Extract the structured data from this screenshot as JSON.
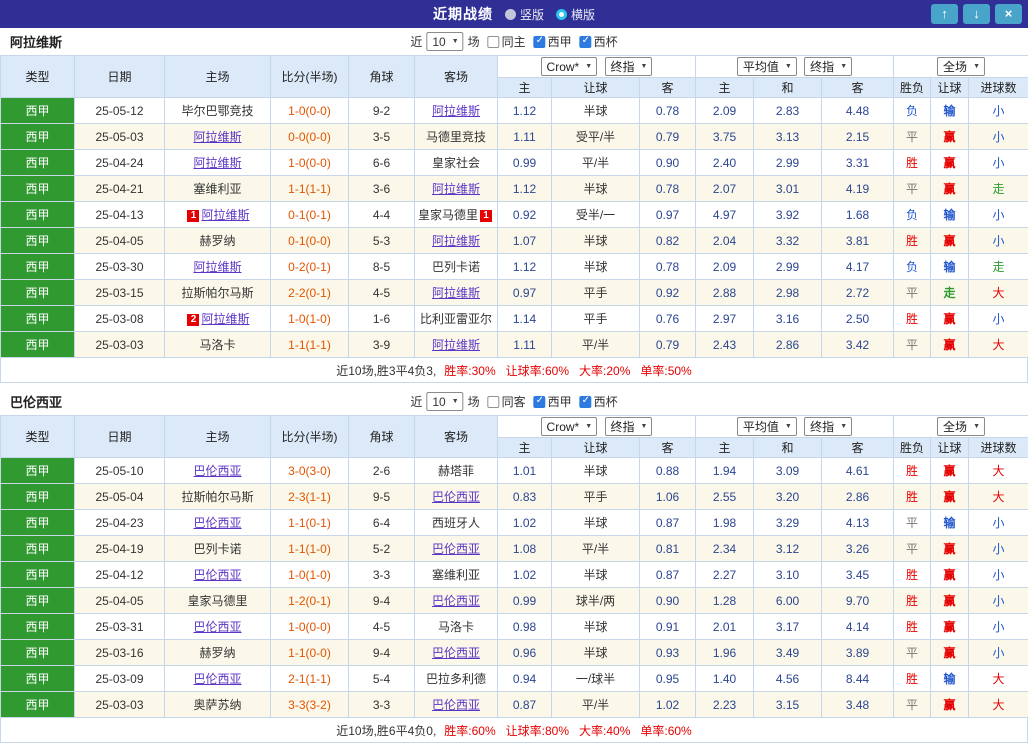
{
  "topbar": {
    "title": "近期战绩",
    "layout_options": [
      {
        "label": "竖版",
        "selected": false
      },
      {
        "label": "横版",
        "selected": true
      }
    ],
    "up_icon": "↑",
    "down_icon": "↓",
    "close_icon": "×"
  },
  "columns": {
    "type": "类型",
    "date": "日期",
    "home": "主场",
    "score": "比分(半场)",
    "corners": "角球",
    "away": "客场",
    "asian_home": "主",
    "asian_line": "让球",
    "asian_away": "客",
    "euro_home": "主",
    "euro_draw": "和",
    "euro_away": "客",
    "outcome": "胜负",
    "handicap": "让球",
    "goals": "进球数"
  },
  "sections": [
    {
      "team": "阿拉维斯",
      "filter": {
        "near_label": "近",
        "count": "10",
        "games_label": "场",
        "checkboxes": [
          {
            "label": "同主",
            "checked": false
          },
          {
            "label": "西甲",
            "checked": true
          },
          {
            "label": "西杯",
            "checked": true
          }
        ]
      },
      "selects": {
        "bookmaker": "Crow*",
        "bookmaker_mode": "终指",
        "euro": "平均值",
        "euro_mode": "终指",
        "scope": "全场"
      },
      "rows": [
        {
          "league": "西甲",
          "date": "25-05-12",
          "home": {
            "name": "毕尔巴鄂竞技"
          },
          "score": "1-0(0-0)",
          "corners": "9-2",
          "away": {
            "name": "阿拉维斯",
            "focal": true
          },
          "asian_home": "1.12",
          "asian_line": "半球",
          "asian_away": "0.78",
          "euro_home": "2.09",
          "euro_draw": "2.83",
          "euro_away": "4.48",
          "outcome": "负",
          "handicap_result": "输",
          "goal_result": "小"
        },
        {
          "league": "西甲",
          "date": "25-05-03",
          "home": {
            "name": "阿拉维斯",
            "focal": true
          },
          "score": "0-0(0-0)",
          "corners": "3-5",
          "away": {
            "name": "马德里竞技"
          },
          "asian_home": "1.11",
          "asian_line": "受平/半",
          "asian_away": "0.79",
          "euro_home": "3.75",
          "euro_draw": "3.13",
          "euro_away": "2.15",
          "outcome": "平",
          "handicap_result": "赢",
          "goal_result": "小"
        },
        {
          "league": "西甲",
          "date": "25-04-24",
          "home": {
            "name": "阿拉维斯",
            "focal": true
          },
          "score": "1-0(0-0)",
          "corners": "6-6",
          "away": {
            "name": "皇家社会"
          },
          "asian_home": "0.99",
          "asian_line": "平/半",
          "asian_away": "0.90",
          "euro_home": "2.40",
          "euro_draw": "2.99",
          "euro_away": "3.31",
          "outcome": "胜",
          "handicap_result": "赢",
          "goal_result": "小"
        },
        {
          "league": "西甲",
          "date": "25-04-21",
          "home": {
            "name": "塞维利亚"
          },
          "score": "1-1(1-1)",
          "corners": "3-6",
          "away": {
            "name": "阿拉维斯",
            "focal": true
          },
          "asian_home": "1.12",
          "asian_line": "半球",
          "asian_away": "0.78",
          "euro_home": "2.07",
          "euro_draw": "3.01",
          "euro_away": "4.19",
          "outcome": "平",
          "handicap_result": "赢",
          "goal_result": "走"
        },
        {
          "league": "西甲",
          "date": "25-04-13",
          "home": {
            "name": "阿拉维斯",
            "focal": true,
            "badge": "1",
            "badge_pos": "before"
          },
          "score": "0-1(0-1)",
          "corners": "4-4",
          "away": {
            "name": "皇家马德里",
            "badge": "1",
            "badge_pos": "after"
          },
          "asian_home": "0.92",
          "asian_line": "受半/一",
          "asian_away": "0.97",
          "euro_home": "4.97",
          "euro_draw": "3.92",
          "euro_away": "1.68",
          "outcome": "负",
          "handicap_result": "输",
          "goal_result": "小"
        },
        {
          "league": "西甲",
          "date": "25-04-05",
          "home": {
            "name": "赫罗纳"
          },
          "score": "0-1(0-0)",
          "corners": "5-3",
          "away": {
            "name": "阿拉维斯",
            "focal": true
          },
          "asian_home": "1.07",
          "asian_line": "半球",
          "asian_away": "0.82",
          "euro_home": "2.04",
          "euro_draw": "3.32",
          "euro_away": "3.81",
          "outcome": "胜",
          "handicap_result": "赢",
          "goal_result": "小"
        },
        {
          "league": "西甲",
          "date": "25-03-30",
          "home": {
            "name": "阿拉维斯",
            "focal": true
          },
          "score": "0-2(0-1)",
          "corners": "8-5",
          "away": {
            "name": "巴列卡诺"
          },
          "asian_home": "1.12",
          "asian_line": "半球",
          "asian_away": "0.78",
          "euro_home": "2.09",
          "euro_draw": "2.99",
          "euro_away": "4.17",
          "outcome": "负",
          "handicap_result": "输",
          "goal_result": "走"
        },
        {
          "league": "西甲",
          "date": "25-03-15",
          "home": {
            "name": "拉斯帕尔马斯"
          },
          "score": "2-2(0-1)",
          "corners": "4-5",
          "away": {
            "name": "阿拉维斯",
            "focal": true
          },
          "asian_home": "0.97",
          "asian_line": "平手",
          "asian_away": "0.92",
          "euro_home": "2.88",
          "euro_draw": "2.98",
          "euro_away": "2.72",
          "outcome": "平",
          "handicap_result": "走",
          "goal_result": "大"
        },
        {
          "league": "西甲",
          "date": "25-03-08",
          "home": {
            "name": "阿拉维斯",
            "focal": true,
            "badge": "2",
            "badge_pos": "before"
          },
          "score": "1-0(1-0)",
          "corners": "1-6",
          "away": {
            "name": "比利亚雷亚尔"
          },
          "asian_home": "1.14",
          "asian_line": "平手",
          "asian_away": "0.76",
          "euro_home": "2.97",
          "euro_draw": "3.16",
          "euro_away": "2.50",
          "outcome": "胜",
          "handicap_result": "赢",
          "goal_result": "小"
        },
        {
          "league": "西甲",
          "date": "25-03-03",
          "home": {
            "name": "马洛卡"
          },
          "score": "1-1(1-1)",
          "corners": "3-9",
          "away": {
            "name": "阿拉维斯",
            "focal": true
          },
          "asian_home": "1.11",
          "asian_line": "平/半",
          "asian_away": "0.79",
          "euro_home": "2.43",
          "euro_draw": "2.86",
          "euro_away": "3.42",
          "outcome": "平",
          "handicap_result": "赢",
          "goal_result": "大"
        }
      ],
      "summary": {
        "prefix": "近10场,胜3平4负3,",
        "stats": [
          "胜率:30%",
          "让球率:60%",
          "大率:20%",
          "单率:50%"
        ]
      }
    },
    {
      "team": "巴伦西亚",
      "filter": {
        "near_label": "近",
        "count": "10",
        "games_label": "场",
        "checkboxes": [
          {
            "label": "同客",
            "checked": false
          },
          {
            "label": "西甲",
            "checked": true
          },
          {
            "label": "西杯",
            "checked": true
          }
        ]
      },
      "selects": {
        "bookmaker": "Crow*",
        "bookmaker_mode": "终指",
        "euro": "平均值",
        "euro_mode": "终指",
        "scope": "全场"
      },
      "rows": [
        {
          "league": "西甲",
          "date": "25-05-10",
          "home": {
            "name": "巴伦西亚",
            "focal": true
          },
          "score": "3-0(3-0)",
          "corners": "2-6",
          "away": {
            "name": "赫塔菲"
          },
          "asian_home": "1.01",
          "asian_line": "半球",
          "asian_away": "0.88",
          "euro_home": "1.94",
          "euro_draw": "3.09",
          "euro_away": "4.61",
          "outcome": "胜",
          "handicap_result": "赢",
          "goal_result": "大"
        },
        {
          "league": "西甲",
          "date": "25-05-04",
          "home": {
            "name": "拉斯帕尔马斯"
          },
          "score": "2-3(1-1)",
          "corners": "9-5",
          "away": {
            "name": "巴伦西亚",
            "focal": true
          },
          "asian_home": "0.83",
          "asian_line": "平手",
          "asian_away": "1.06",
          "euro_home": "2.55",
          "euro_draw": "3.20",
          "euro_away": "2.86",
          "outcome": "胜",
          "handicap_result": "赢",
          "goal_result": "大"
        },
        {
          "league": "西甲",
          "date": "25-04-23",
          "home": {
            "name": "巴伦西亚",
            "focal": true
          },
          "score": "1-1(0-1)",
          "corners": "6-4",
          "away": {
            "name": "西班牙人"
          },
          "asian_home": "1.02",
          "asian_line": "半球",
          "asian_away": "0.87",
          "euro_home": "1.98",
          "euro_draw": "3.29",
          "euro_away": "4.13",
          "outcome": "平",
          "handicap_result": "输",
          "goal_result": "小"
        },
        {
          "league": "西甲",
          "date": "25-04-19",
          "home": {
            "name": "巴列卡诺"
          },
          "score": "1-1(1-0)",
          "corners": "5-2",
          "away": {
            "name": "巴伦西亚",
            "focal": true
          },
          "asian_home": "1.08",
          "asian_line": "平/半",
          "asian_away": "0.81",
          "euro_home": "2.34",
          "euro_draw": "3.12",
          "euro_away": "3.26",
          "outcome": "平",
          "handicap_result": "赢",
          "goal_result": "小"
        },
        {
          "league": "西甲",
          "date": "25-04-12",
          "home": {
            "name": "巴伦西亚",
            "focal": true
          },
          "score": "1-0(1-0)",
          "corners": "3-3",
          "away": {
            "name": "塞维利亚"
          },
          "asian_home": "1.02",
          "asian_line": "半球",
          "asian_away": "0.87",
          "euro_home": "2.27",
          "euro_draw": "3.10",
          "euro_away": "3.45",
          "outcome": "胜",
          "handicap_result": "赢",
          "goal_result": "小"
        },
        {
          "league": "西甲",
          "date": "25-04-05",
          "home": {
            "name": "皇家马德里"
          },
          "score": "1-2(0-1)",
          "corners": "9-4",
          "away": {
            "name": "巴伦西亚",
            "focal": true
          },
          "asian_home": "0.99",
          "asian_line": "球半/两",
          "asian_away": "0.90",
          "euro_home": "1.28",
          "euro_draw": "6.00",
          "euro_away": "9.70",
          "outcome": "胜",
          "handicap_result": "赢",
          "goal_result": "小"
        },
        {
          "league": "西甲",
          "date": "25-03-31",
          "home": {
            "name": "巴伦西亚",
            "focal": true
          },
          "score": "1-0(0-0)",
          "corners": "4-5",
          "away": {
            "name": "马洛卡"
          },
          "asian_home": "0.98",
          "asian_line": "半球",
          "asian_away": "0.91",
          "euro_home": "2.01",
          "euro_draw": "3.17",
          "euro_away": "4.14",
          "outcome": "胜",
          "handicap_result": "赢",
          "goal_result": "小"
        },
        {
          "league": "西甲",
          "date": "25-03-16",
          "home": {
            "name": "赫罗纳"
          },
          "score": "1-1(0-0)",
          "corners": "9-4",
          "away": {
            "name": "巴伦西亚",
            "focal": true
          },
          "asian_home": "0.96",
          "asian_line": "半球",
          "asian_away": "0.93",
          "euro_home": "1.96",
          "euro_draw": "3.49",
          "euro_away": "3.89",
          "outcome": "平",
          "handicap_result": "赢",
          "goal_result": "小"
        },
        {
          "league": "西甲",
          "date": "25-03-09",
          "home": {
            "name": "巴伦西亚",
            "focal": true
          },
          "score": "2-1(1-1)",
          "corners": "5-4",
          "away": {
            "name": "巴拉多利德"
          },
          "asian_home": "0.94",
          "asian_line": "一/球半",
          "asian_away": "0.95",
          "euro_home": "1.40",
          "euro_draw": "4.56",
          "euro_away": "8.44",
          "outcome": "胜",
          "handicap_result": "输",
          "goal_result": "大"
        },
        {
          "league": "西甲",
          "date": "25-03-03",
          "home": {
            "name": "奥萨苏纳"
          },
          "score": "3-3(3-2)",
          "corners": "3-3",
          "away": {
            "name": "巴伦西亚",
            "focal": true
          },
          "asian_home": "0.87",
          "asian_line": "平/半",
          "asian_away": "1.02",
          "euro_home": "2.23",
          "euro_draw": "3.15",
          "euro_away": "3.48",
          "outcome": "平",
          "handicap_result": "赢",
          "goal_result": "大"
        }
      ],
      "summary": {
        "prefix": "近10场,胜6平4负0,",
        "stats": [
          "胜率:60%",
          "让球率:80%",
          "大率:40%",
          "单率:60%"
        ]
      }
    }
  ]
}
